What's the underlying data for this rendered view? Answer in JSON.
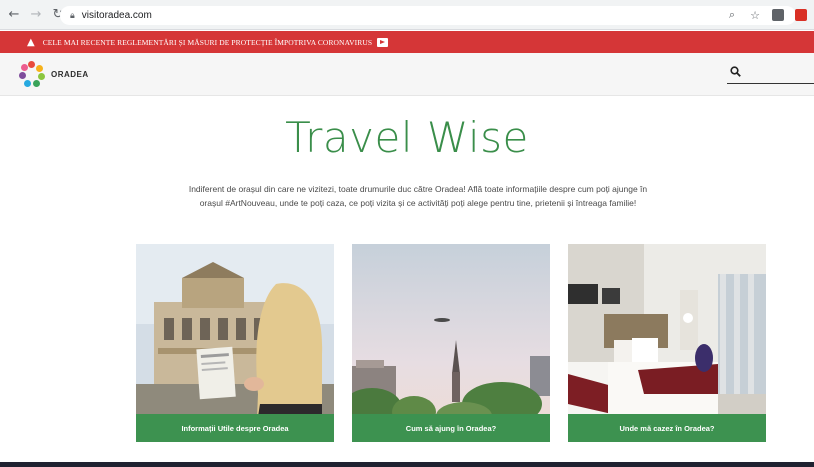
{
  "browser": {
    "url": "visitoradea.com",
    "icons": [
      "back-icon",
      "forward-icon",
      "reload-icon",
      "lock-icon",
      "zoom-icon",
      "star-icon",
      "extension-icon"
    ]
  },
  "alert": {
    "text": "CELE MAI RECENTE REGLEMENTĂRI ȘI MĂSURI DE PROTECȚIE ÎMPOTRIVA CORONAVIRUS",
    "color": "#d53637"
  },
  "header": {
    "logo_text": "ORADEA",
    "search_icon": "search-icon"
  },
  "main": {
    "title": "Travel Wise",
    "intro": "Indiferent de orașul din care ne vizitezi, toate drumurile duc către Oradea! Află toate informațiile despre cum poți ajunge în orașul #ArtNouveau, unde te poți caza, ce poți vizita și ce activități poți alege pentru tine, prietenii și întreaga familie!",
    "accent_color": "#3a8e4a",
    "cards": [
      {
        "label": "Informații Utile despre Oradea"
      },
      {
        "label": "Cum să ajung în Oradea?"
      },
      {
        "label": "Unde mă cazez în Oradea?"
      }
    ]
  }
}
